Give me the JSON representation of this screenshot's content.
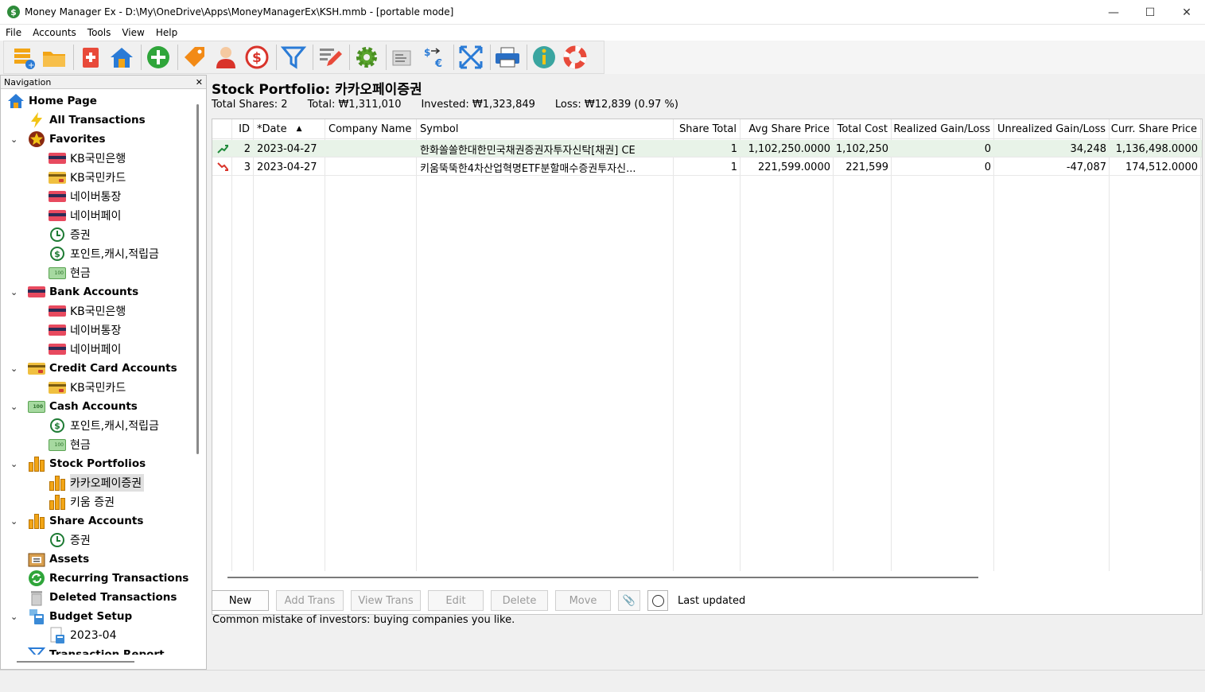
{
  "window": {
    "title": "Money Manager Ex - D:\\My\\OneDrive\\Apps\\MoneyManagerEx\\KSH.mmb -  [portable mode]",
    "minimize": "—",
    "maximize": "☐",
    "close": "✕"
  },
  "menu": [
    "File",
    "Accounts",
    "Tools",
    "View",
    "Help"
  ],
  "toolbar": [
    {
      "icon": "new-database-icon"
    },
    {
      "icon": "open-folder-icon"
    },
    {
      "icon": "new-account-icon"
    },
    {
      "icon": "home-icon"
    },
    {
      "icon": "add-transaction-icon"
    },
    {
      "icon": "category-tag-icon"
    },
    {
      "icon": "payee-person-icon"
    },
    {
      "icon": "currency-dollar-icon"
    },
    {
      "icon": "filter-icon"
    },
    {
      "icon": "edit-pencil-icon"
    },
    {
      "icon": "settings-gear-icon"
    },
    {
      "icon": "report-icon"
    },
    {
      "icon": "currency-exchange-icon"
    },
    {
      "icon": "fullscreen-icon"
    },
    {
      "icon": "print-icon"
    },
    {
      "icon": "info-icon"
    },
    {
      "icon": "help-lifebuoy-icon"
    }
  ],
  "nav": {
    "header": "Navigation",
    "close": "✕",
    "items": [
      {
        "label": "Home Page",
        "icon": "home-icon",
        "level": 0,
        "bold": true
      },
      {
        "label": "All Transactions",
        "icon": "lightning-icon",
        "level": 1,
        "bold": true
      },
      {
        "label": "Favorites",
        "icon": "star-icon",
        "level": 1,
        "bold": true,
        "expanded": true
      },
      {
        "label": "KB국민은행",
        "icon": "bank-card-icon",
        "level": 2
      },
      {
        "label": "KB국민카드",
        "icon": "credit-card-icon",
        "level": 2
      },
      {
        "label": "네이버통장",
        "icon": "bank-card-icon",
        "level": 2
      },
      {
        "label": "네이버페이",
        "icon": "bank-card-icon",
        "level": 2
      },
      {
        "label": "증권",
        "icon": "clock-icon",
        "level": 2
      },
      {
        "label": "포인트,캐시,적립금",
        "icon": "dollar-circle-icon",
        "level": 2
      },
      {
        "label": "현금",
        "icon": "cash-icon",
        "level": 2
      },
      {
        "label": "Bank Accounts",
        "icon": "bank-card-icon",
        "level": 1,
        "bold": true,
        "expanded": true
      },
      {
        "label": "KB국민은행",
        "icon": "bank-card-icon",
        "level": 2
      },
      {
        "label": "네이버통장",
        "icon": "bank-card-icon",
        "level": 2
      },
      {
        "label": "네이버페이",
        "icon": "bank-card-icon",
        "level": 2
      },
      {
        "label": "Credit Card Accounts",
        "icon": "credit-card-icon",
        "level": 1,
        "bold": true,
        "expanded": true
      },
      {
        "label": "KB국민카드",
        "icon": "credit-card-icon",
        "level": 2
      },
      {
        "label": "Cash Accounts",
        "icon": "cash-icon",
        "level": 1,
        "bold": true,
        "expanded": true
      },
      {
        "label": "포인트,캐시,적립금",
        "icon": "dollar-circle-icon",
        "level": 2
      },
      {
        "label": "현금",
        "icon": "cash-icon",
        "level": 2
      },
      {
        "label": "Stock Portfolios",
        "icon": "stock-bars-icon",
        "level": 1,
        "bold": true,
        "expanded": true
      },
      {
        "label": "카카오페이증권",
        "icon": "stock-bars-icon",
        "level": 2,
        "selected": true
      },
      {
        "label": "키움 증권",
        "icon": "stock-bars-icon",
        "level": 2
      },
      {
        "label": "Share Accounts",
        "icon": "stock-bars-icon",
        "level": 1,
        "bold": true,
        "expanded": true
      },
      {
        "label": "증권",
        "icon": "clock-icon",
        "level": 2
      },
      {
        "label": "Assets",
        "icon": "assets-box-icon",
        "level": 1,
        "bold": true
      },
      {
        "label": "Recurring Transactions",
        "icon": "recurring-arrows-icon",
        "level": 1,
        "bold": true
      },
      {
        "label": "Deleted Transactions",
        "icon": "trash-icon",
        "level": 1,
        "bold": true
      },
      {
        "label": "Budget Setup",
        "icon": "calculator-icon",
        "level": 1,
        "bold": true,
        "expanded": true
      },
      {
        "label": "2023-04",
        "icon": "budget-calculator-icon",
        "level": 2
      },
      {
        "label": "Transaction Report",
        "icon": "filter-icon",
        "level": 1,
        "bold": true
      }
    ]
  },
  "portfolio": {
    "title": "Stock Portfolio: 카카오페이증권",
    "total_shares": "Total Shares: 2",
    "total": "Total: ₩1,311,010",
    "invested": "Invested: ₩1,323,849",
    "loss": "Loss: ₩12,839 (0.97 %)"
  },
  "table": {
    "columns": [
      "ID",
      "*Date",
      "Company Name",
      "Symbol",
      "Share Total",
      "Avg Share Price",
      "Total Cost",
      "Realized Gain/Loss",
      "Unrealized Gain/Loss",
      "Curr. Share Price"
    ],
    "sort_indicator": "▲",
    "rows": [
      {
        "trend": "up-arrow-icon",
        "cells": [
          "2",
          "2023-04-27",
          "",
          "한화쏠쏠한대한민국채권증권자투자신탁[채권] CE",
          "1",
          "1,102,250.0000",
          "1,102,250",
          "0",
          "34,248",
          "1,136,498.0000"
        ]
      },
      {
        "trend": "down-arrow-icon",
        "cells": [
          "3",
          "2023-04-27",
          "",
          "키움뚝뚝한4차산업혁명ETF분할매수증권투자신...",
          "1",
          "221,599.0000",
          "221,599",
          "0",
          "-47,087",
          "174,512.0000"
        ]
      }
    ]
  },
  "buttons": {
    "new": "New",
    "add_trans": "Add Trans",
    "view_trans": "View Trans",
    "edit": "Edit",
    "delete": "Delete",
    "move": "Move",
    "attach": "📎",
    "last_updated": "Last updated"
  },
  "hint": "Common mistake of investors: buying companies you like.",
  "colors": {
    "up": "#1f8a3a",
    "down": "#d9342b",
    "row_highlight": "#e8f3e8"
  }
}
